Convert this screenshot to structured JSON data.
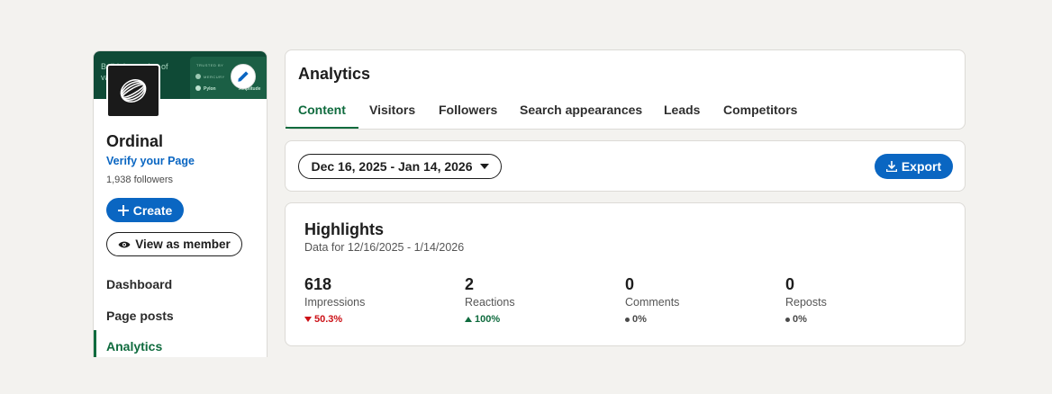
{
  "profile": {
    "banner_text": "Build the engine of value.",
    "banner_panel": {
      "trusted": "TRUSTED BY",
      "mercury": "MERCURY",
      "pylon": "Pylon",
      "amplitude": "Amplitude"
    },
    "name": "Ordinal",
    "verify_link": "Verify your Page",
    "followers": "1,938 followers",
    "create_label": "Create",
    "view_member_label": "View as member",
    "nav": [
      {
        "label": "Dashboard"
      },
      {
        "label": "Page posts"
      },
      {
        "label": "Analytics",
        "active": true
      }
    ]
  },
  "analytics": {
    "title": "Analytics",
    "tabs": [
      {
        "label": "Content",
        "active": true
      },
      {
        "label": "Visitors"
      },
      {
        "label": "Followers"
      },
      {
        "label": "Search appearances"
      },
      {
        "label": "Leads"
      },
      {
        "label": "Competitors"
      }
    ]
  },
  "filters": {
    "date_range": "Dec 16, 2025 - Jan 14, 2026",
    "export_label": "Export"
  },
  "highlights": {
    "title": "Highlights",
    "subtitle": "Data for 12/16/2025 - 1/14/2026",
    "metrics": [
      {
        "value": "618",
        "label": "Impressions",
        "change": "50.3%",
        "trend": "down"
      },
      {
        "value": "2",
        "label": "Reactions",
        "change": "100%",
        "trend": "up"
      },
      {
        "value": "0",
        "label": "Comments",
        "change": "0%",
        "trend": "neutral"
      },
      {
        "value": "0",
        "label": "Reposts",
        "change": "0%",
        "trend": "neutral"
      }
    ]
  },
  "colors": {
    "brand_blue": "#0a66c2",
    "active_green": "#0f6b3e",
    "negative_red": "#cc1016",
    "background": "#f3f2ef"
  }
}
